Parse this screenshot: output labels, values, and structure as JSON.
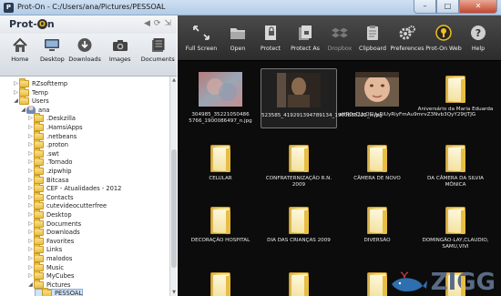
{
  "window": {
    "title": "Prot-On - C:/Users/ana/Pictures/PESSOAL",
    "app_icon_letter": "P",
    "min": "–",
    "max": "□",
    "close": "✕"
  },
  "logo": {
    "prefix": "Prot-",
    "o": "O",
    "suffix": "n"
  },
  "left_toolbar": [
    {
      "label": "Home",
      "icon": "house-icon"
    },
    {
      "label": "Desktop",
      "icon": "monitor-icon"
    },
    {
      "label": "Downloads",
      "icon": "download-icon"
    },
    {
      "label": "Images",
      "icon": "camera-icon"
    },
    {
      "label": "Documents",
      "icon": "documents-icon"
    }
  ],
  "nav": {
    "back": "◀",
    "refresh": "⟳",
    "pin": "⇲"
  },
  "tree": [
    {
      "label": "RZsofttemp",
      "indent": 1,
      "exp": "▷",
      "kind": "folder"
    },
    {
      "label": "Temp",
      "indent": 1,
      "exp": "▷",
      "kind": "folder"
    },
    {
      "label": "Users",
      "indent": 1,
      "exp": "◢",
      "kind": "folder"
    },
    {
      "label": "ana",
      "indent": 2,
      "exp": "◢",
      "kind": "user"
    },
    {
      "label": ".Deskzilla",
      "indent": 3,
      "exp": "▷",
      "kind": "folder"
    },
    {
      "label": ".HamsiApps",
      "indent": 3,
      "exp": "▷",
      "kind": "folder"
    },
    {
      "label": ".netbeans",
      "indent": 3,
      "exp": "▷",
      "kind": "folder"
    },
    {
      "label": ".proton",
      "indent": 3,
      "exp": "▷",
      "kind": "folder"
    },
    {
      "label": ".swt",
      "indent": 3,
      "exp": "▷",
      "kind": "folder"
    },
    {
      "label": ".Tornado",
      "indent": 3,
      "exp": "▷",
      "kind": "folder"
    },
    {
      "label": ".zipwhip",
      "indent": 3,
      "exp": "▷",
      "kind": "folder"
    },
    {
      "label": "Bitcasa",
      "indent": 3,
      "exp": "▷",
      "kind": "folder"
    },
    {
      "label": "CEF - Atualidades - 2012",
      "indent": 3,
      "exp": "▷",
      "kind": "folder"
    },
    {
      "label": "Contacts",
      "indent": 3,
      "exp": "▷",
      "kind": "folder"
    },
    {
      "label": "cutevideocutterfree",
      "indent": 3,
      "exp": "▷",
      "kind": "folder"
    },
    {
      "label": "Desktop",
      "indent": 3,
      "exp": "▷",
      "kind": "folder"
    },
    {
      "label": "Documents",
      "indent": 3,
      "exp": "▷",
      "kind": "folder"
    },
    {
      "label": "Downloads",
      "indent": 3,
      "exp": "▷",
      "kind": "folder"
    },
    {
      "label": "Favorites",
      "indent": 3,
      "exp": "▷",
      "kind": "folder"
    },
    {
      "label": "Links",
      "indent": 3,
      "exp": "▷",
      "kind": "folder"
    },
    {
      "label": "malodos",
      "indent": 3,
      "exp": "▷",
      "kind": "folder"
    },
    {
      "label": "Music",
      "indent": 3,
      "exp": "▷",
      "kind": "folder"
    },
    {
      "label": "MyCubes",
      "indent": 3,
      "exp": "▷",
      "kind": "folder"
    },
    {
      "label": "Pictures",
      "indent": 3,
      "exp": "◢",
      "kind": "folder"
    },
    {
      "label": "PESSOAL",
      "indent": 4,
      "exp": "",
      "kind": "folder",
      "selected": true
    }
  ],
  "right_toolbar": [
    {
      "label": "Full Screen",
      "icon": "fullscreen-icon",
      "enabled": true
    },
    {
      "label": "Open",
      "icon": "open-folder-icon",
      "enabled": true
    },
    {
      "label": "Protect",
      "icon": "protect-icon",
      "enabled": true
    },
    {
      "label": "Protect As",
      "icon": "protect-as-icon",
      "enabled": true
    },
    {
      "label": "Dropbox",
      "icon": "dropbox-icon",
      "enabled": false
    },
    {
      "label": "Clipboard",
      "icon": "clipboard-icon",
      "enabled": true
    },
    {
      "label": "Preferences",
      "icon": "gear-icon",
      "enabled": true
    },
    {
      "label": "Prot-On Web",
      "icon": "prot-on-web-icon",
      "enabled": true
    },
    {
      "label": "Help",
      "icon": "help-icon",
      "enabled": true
    }
  ],
  "files": [
    {
      "caption": "304985_35221050486 5766_1900086497_n.jpg",
      "kind": "photo-blur"
    },
    {
      "caption": "523585_419291394789134_1900830222_n.jpg",
      "kind": "photo-dark",
      "selected": true
    },
    {
      "caption": "aHR0cCUzQSUyRiUyRiyFmAu9mrvZ3Nvb3QyY29tJTJG",
      "kind": "photo-face"
    },
    {
      "caption": "Aniversário da Maria Eduarda",
      "kind": "folder"
    },
    {
      "caption": "CELULAR",
      "kind": "folder"
    },
    {
      "caption": "CONFRATERNIZAÇÃO R.N. 2009",
      "kind": "folder"
    },
    {
      "caption": "CÂMERA DE NOVO",
      "kind": "folder"
    },
    {
      "caption": "DA CÂMERA DA SILVIA MÔNICA",
      "kind": "folder"
    },
    {
      "caption": "DECORAÇÃO HOSPITAL",
      "kind": "folder"
    },
    {
      "caption": "DIA DAS CRIANÇAS 2009",
      "kind": "folder"
    },
    {
      "caption": "DIVERSÃO",
      "kind": "folder"
    },
    {
      "caption": "DOMINGÃO-LAY,CLAUDIO, SAMU,VIVI",
      "kind": "folder"
    },
    {
      "caption": "",
      "kind": "folder"
    },
    {
      "caption": "",
      "kind": "folder"
    },
    {
      "caption": "",
      "kind": "folder"
    },
    {
      "caption": "",
      "kind": "folder"
    }
  ],
  "watermark": {
    "text": "ZIGG"
  },
  "colors": {
    "accent": "#f2c21c",
    "dark_bg": "#0c0c0c",
    "selection": "#cfe4f8"
  }
}
